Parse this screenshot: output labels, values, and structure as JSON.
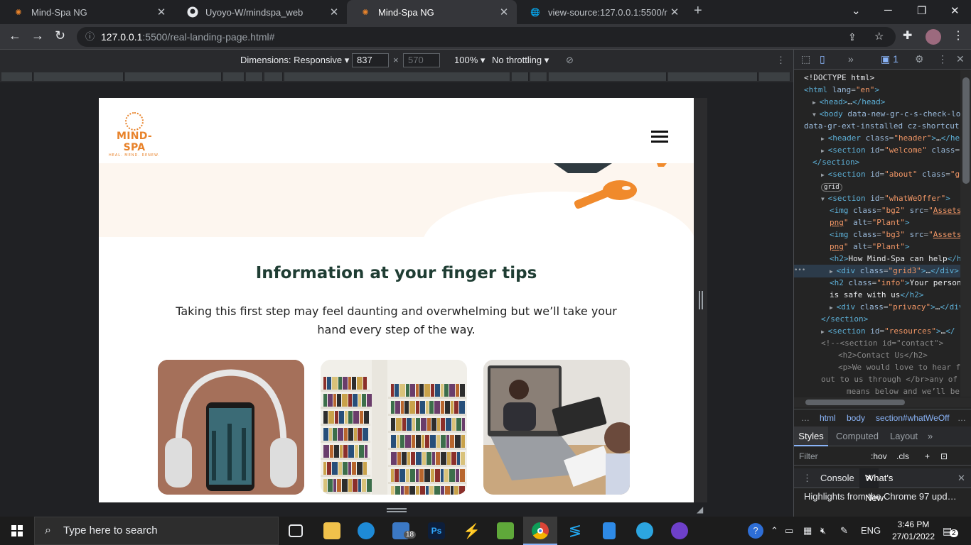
{
  "browser": {
    "tabs": [
      {
        "title": "Mind-Spa NG",
        "icon": "mindspa-icon",
        "active": false
      },
      {
        "title": "Uyoyo-W/mindspa_web",
        "icon": "github-icon",
        "active": false
      },
      {
        "title": "Mind-Spa NG",
        "icon": "mindspa-icon",
        "active": true
      },
      {
        "title": "view-source:127.0.0.1:5500/real-l",
        "icon": "globe-icon",
        "active": false
      }
    ],
    "url_host": "127.0.0.1",
    "url_rest": ":5500/real-landing-page.html#"
  },
  "device_toolbar": {
    "dimensions_label": "Dimensions: Responsive",
    "width": "837",
    "height": "570",
    "times": "×",
    "zoom": "100%",
    "throttling": "No throttling"
  },
  "site": {
    "logo_text": "MIND-SPA",
    "logo_tagline": "HEAL. MEND. RENEW.",
    "section_title": "Information at your finger tips",
    "section_text": "Taking this first step may feel daunting and overwhelming but we’ll take your hand every step of the way.",
    "cards": [
      {
        "name": "headphones-phone-image"
      },
      {
        "name": "library-bookshelf-image"
      },
      {
        "name": "video-call-study-image"
      }
    ]
  },
  "devtools": {
    "issue_count": "1",
    "elements": [
      {
        "indent": 0,
        "arrow": "",
        "html": "<span class='tx'>&lt;!DOCTYPE html&gt;</span>"
      },
      {
        "indent": 0,
        "arrow": "",
        "html": "<span class='tg'>&lt;html</span> <span class='at'>lang</span>=<span class='av'>\"en\"</span><span class='tg'>&gt;</span>"
      },
      {
        "indent": 1,
        "arrow": "▶",
        "html": "<span class='tg'>&lt;head&gt;</span><span class='tx'>…</span><span class='tg'>&lt;/head&gt;</span>"
      },
      {
        "indent": 1,
        "arrow": "▼",
        "html": "<span class='tg'>&lt;body</span> <span class='at'>data-new-gr-c-s-check-load</span>"
      },
      {
        "indent": 0,
        "arrow": "",
        "html": "<span class='at'>data-gr-ext-installed cz-shortcut</span>"
      },
      {
        "indent": 2,
        "arrow": "▶",
        "html": "<span class='tg'>&lt;header</span> <span class='at'>class</span>=<span class='av'>\"header\"</span><span class='tg'>&gt;</span><span class='tx'>…</span><span class='tg'>&lt;/head</span>"
      },
      {
        "indent": 2,
        "arrow": "▶",
        "html": "<span class='tg'>&lt;section</span> <span class='at'>id</span>=<span class='av'>\"welcome\"</span> <span class='at'>class</span>=<span class='av'>\"h</span>"
      },
      {
        "indent": 1,
        "arrow": "",
        "html": "<span class='tg'>&lt;/section&gt;</span>"
      },
      {
        "indent": 2,
        "arrow": "▶",
        "html": "<span class='tg'>&lt;section</span> <span class='at'>id</span>=<span class='av'>\"about\"</span> <span class='at'>class</span>=<span class='av'>\"gri</span>"
      },
      {
        "indent": 2,
        "arrow": "",
        "html": "<span class='tx' style='font-size:9px;border:1px solid #777;border-radius:6px;padding:0 3px'>grid</span>"
      },
      {
        "indent": 2,
        "arrow": "▼",
        "html": "<span class='tg'>&lt;section</span> <span class='at'>id</span>=<span class='av'>\"whatWeOffer\"</span><span class='tg'>&gt;</span>"
      },
      {
        "indent": 3,
        "arrow": "",
        "html": "<span class='tg'>&lt;img</span> <span class='at'>class</span>=<span class='av'>\"bg2\"</span> <span class='at'>src</span>=<span class='av'>\"<u>Assets</u></span>"
      },
      {
        "indent": 3,
        "arrow": "",
        "html": "<span class='av'><u>png</u>\"</span> <span class='at'>alt</span>=<span class='av'>\"Plant\"</span><span class='tg'>&gt;</span>"
      },
      {
        "indent": 3,
        "arrow": "",
        "html": "<span class='tg'>&lt;img</span> <span class='at'>class</span>=<span class='av'>\"bg3\"</span> <span class='at'>src</span>=<span class='av'>\"<u>Assets</u></span>"
      },
      {
        "indent": 3,
        "arrow": "",
        "html": "<span class='av'><u>png</u>\"</span> <span class='at'>alt</span>=<span class='av'>\"Plant\"</span><span class='tg'>&gt;</span>"
      },
      {
        "indent": 3,
        "arrow": "",
        "html": "<span class='tg'>&lt;h2&gt;</span><span class='tx'>How Mind-Spa can help</span><span class='tg'>&lt;/h</span>"
      },
      {
        "indent": 3,
        "arrow": "▶",
        "html": "<span class='tg'>&lt;div</span> <span class='at'>class</span>=<span class='av'>\"grid3\"</span><span class='tg'>&gt;</span><span class='tx'>…</span><span class='tg'>&lt;/div&gt;</span>",
        "selected": true
      },
      {
        "indent": 3,
        "arrow": "",
        "html": "<span class='tg'>&lt;h2</span> <span class='at'>class</span>=<span class='av'>\"info\"</span><span class='tg'>&gt;</span><span class='tx'>Your person</span>"
      },
      {
        "indent": 3,
        "arrow": "",
        "html": "<span class='tx'>is safe with us</span><span class='tg'>&lt;/h2&gt;</span>"
      },
      {
        "indent": 3,
        "arrow": "▶",
        "html": "<span class='tg'>&lt;div</span> <span class='at'>class</span>=<span class='av'>\"privacy\"</span><span class='tg'>&gt;</span><span class='tx'>…</span><span class='tg'>&lt;/div&gt;</span>"
      },
      {
        "indent": 2,
        "arrow": "",
        "html": "<span class='tg'>&lt;/section&gt;</span>"
      },
      {
        "indent": 2,
        "arrow": "▶",
        "html": "<span class='tg'>&lt;section</span> <span class='at'>id</span>=<span class='av'>\"resources\"</span><span class='tg'>&gt;</span><span class='tx'>…</span><span class='tg'>&lt;/</span>"
      },
      {
        "indent": 2,
        "arrow": "",
        "html": "<span class='cm'>&lt;!--&lt;section id=\"contact\"&gt;</span>"
      },
      {
        "indent": 4,
        "arrow": "",
        "html": "<span class='cm'>&lt;h2&gt;Contact Us&lt;/h2&gt;</span>"
      },
      {
        "indent": 4,
        "arrow": "",
        "html": "<span class='cm'>&lt;p&gt;We would love to hear f</span>"
      },
      {
        "indent": 2,
        "arrow": "",
        "html": "<span class='cm'>out to us through &lt;/br&gt;any of</span>"
      },
      {
        "indent": 5,
        "arrow": "",
        "html": "<span class='cm'>means below and we’ll be</span>"
      }
    ],
    "breadcrumbs": [
      "…",
      "html",
      "body",
      "section#whatWeOff",
      "…"
    ],
    "style_tabs": [
      "Styles",
      "Computed",
      "Layout",
      "»"
    ],
    "filter_placeholder": "Filter",
    "hov": ":hov",
    "cls": ".cls",
    "drawer_tabs": [
      "Console",
      "What's New"
    ],
    "whats_new_text": "Highlights from the Chrome 97 upd…"
  },
  "taskbar": {
    "search_placeholder": "Type here to search",
    "mail_badge": "18",
    "lang": "ENG",
    "time": "3:46 PM",
    "date": "27/01/2022",
    "notif_count": "2"
  }
}
